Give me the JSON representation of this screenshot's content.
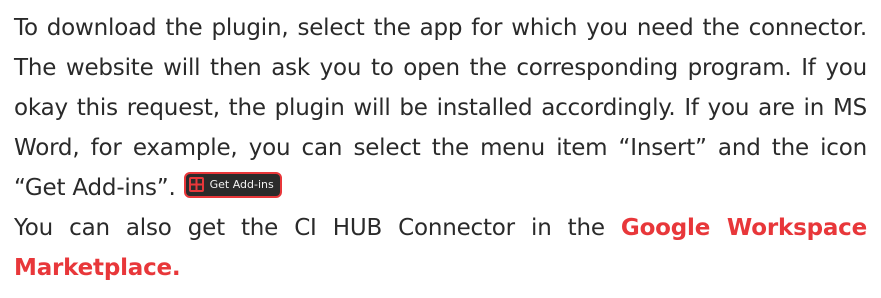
{
  "paragraph1": {
    "text": "To download the plugin, select the app for which you need the connector. The website will then ask you to open the correspond­ing program. If you okay this request, the plugin will be installed accordingly. If you are in MS Word, for example, you can select the menu item “Insert” and the icon “Get Add-ins”."
  },
  "addins_badge": {
    "label": "Get Add-ins",
    "icon": "grid-add-icon"
  },
  "paragraph2": {
    "text": "You can also get the CI HUB Connector in the",
    "link_text": "Google Workspace Marketplace."
  },
  "colors": {
    "text": "#2a2a2a",
    "accent": "#e8373a",
    "badge_bg": "#2b2b2b"
  }
}
